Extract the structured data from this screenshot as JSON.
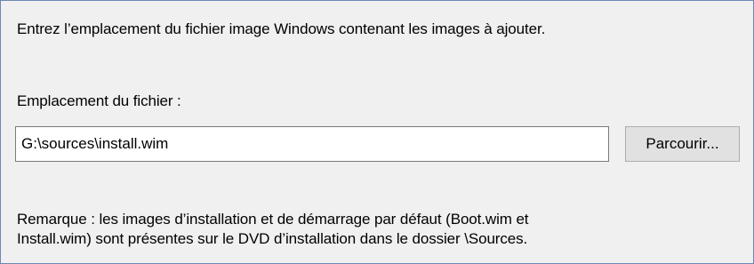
{
  "wizard_page": {
    "instruction": "Entrez l’emplacement du fichier image Windows contenant les images à ajouter.",
    "location_label": "Emplacement du fichier :",
    "path_value": "G:\\sources\\install.wim",
    "browse_label": "Parcourir...",
    "note_line_1": "Remarque : les images d’installation et de démarrage par défaut (Boot.wim et",
    "note_line_2": "Install.wim) sont présentes sur le DVD d’installation dans le dossier \\Sources."
  }
}
